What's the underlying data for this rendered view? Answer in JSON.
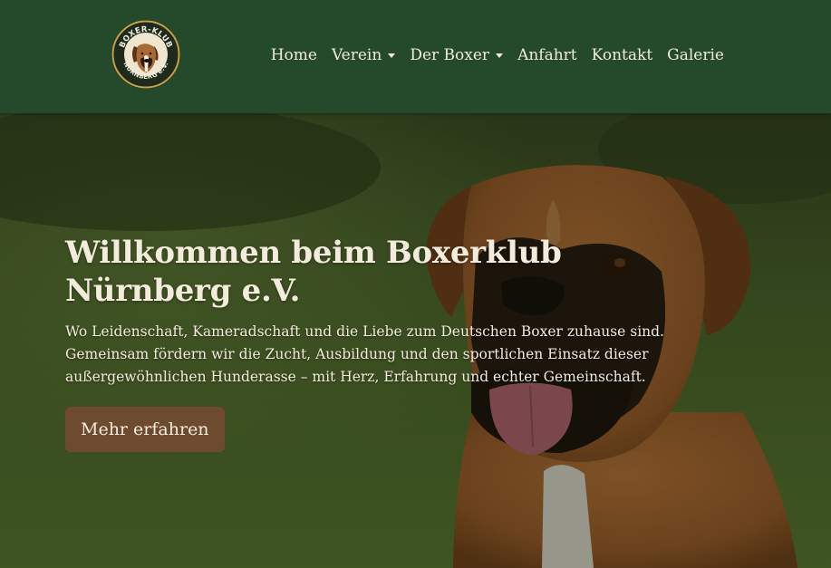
{
  "colors": {
    "nav_background": "#244a2b",
    "nav_text": "#f3ecdc",
    "button_background": "#6e4a2f",
    "logo_ring": "#c8a14a"
  },
  "logo": {
    "top_text": "BOXER-KLUB",
    "bottom_text": "NÜRNBERG e.V.",
    "icon": "boxer-dog-emblem-icon"
  },
  "nav": {
    "items": [
      {
        "label": "Home",
        "dropdown": false
      },
      {
        "label": "Verein",
        "dropdown": true
      },
      {
        "label": "Der Boxer",
        "dropdown": true
      },
      {
        "label": "Anfahrt",
        "dropdown": false
      },
      {
        "label": "Kontakt",
        "dropdown": false
      },
      {
        "label": "Galerie",
        "dropdown": false
      }
    ]
  },
  "hero": {
    "title_line1": "Willkommen beim Boxerklub",
    "title_line2": "Nürnberg e.V.",
    "text": "Wo Leidenschaft, Kameradschaft und die Liebe zum Deutschen Boxer zuhause sind. Gemeinsam fördern wir die Zucht, Ausbildung und den sportlichen Einsatz dieser außergewöhnlichen Hunderasse – mit Herz, Erfahrung und echter Gemeinschaft.",
    "button_label": "Mehr erfahren",
    "background_image": "boxer-dog-photo"
  }
}
